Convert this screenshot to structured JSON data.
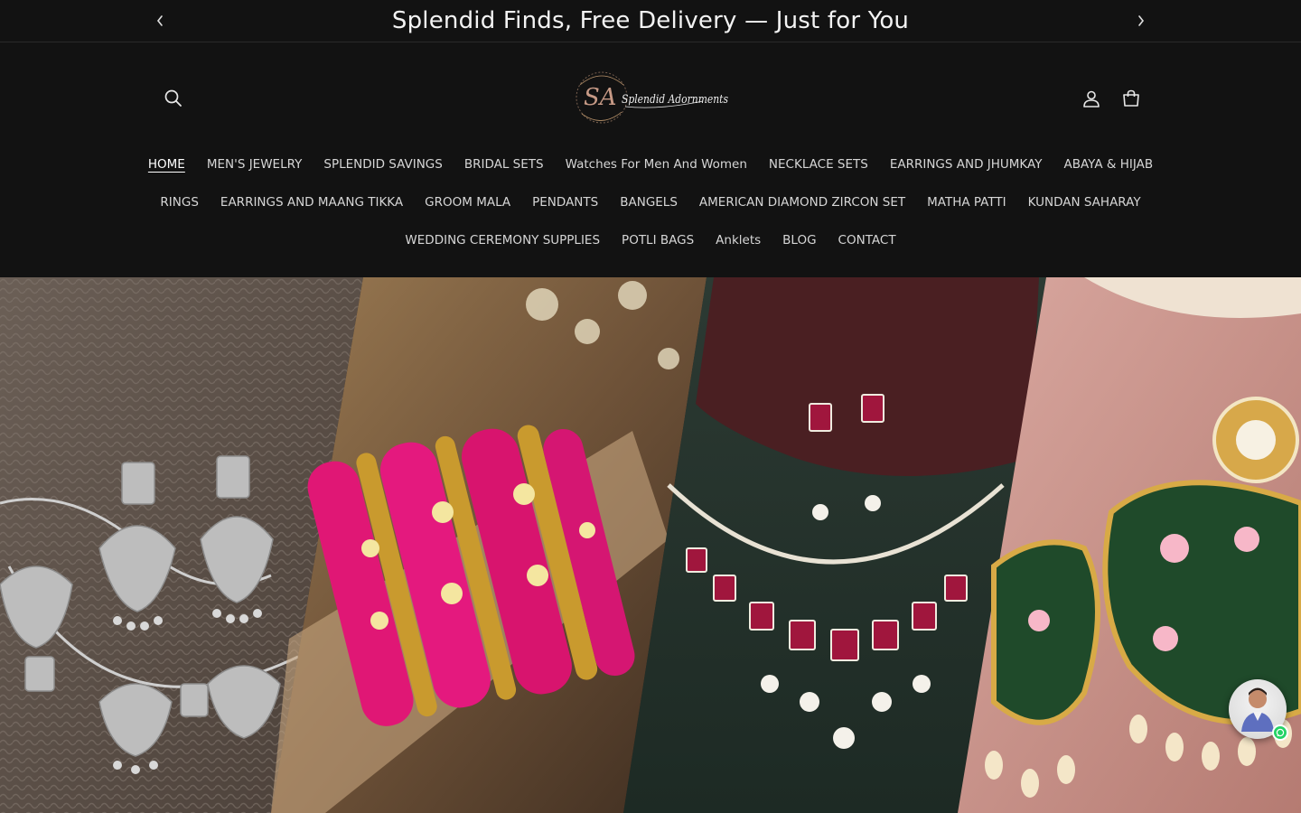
{
  "announcement": {
    "text": "Splendid Finds, Free Delivery — Just for You"
  },
  "header": {
    "logo_monogram": "SA",
    "logo_script": "Splendid Adornments",
    "icons": [
      "search-icon",
      "account-icon",
      "cart-icon"
    ]
  },
  "nav": {
    "row1": [
      "HOME",
      "MEN'S JEWELRY",
      "SPLENDID SAVINGS",
      "BRIDAL SETS",
      "Watches For Men And Women",
      "NECKLACE SETS",
      "EARRINGS AND JHUMKAY",
      "ABAYA & HIJAB"
    ],
    "row2": [
      "RINGS",
      "EARRINGS AND MAANG TIKKA",
      "GROOM MALA",
      "PENDANTS",
      "BANGELS",
      "AMERICAN DIAMOND ZIRCON SET",
      "MATHA PATTI",
      "KUNDAN SAHARAY"
    ],
    "row3": [
      "WEDDING CEREMONY SUPPLIES",
      "POTLI BAGS",
      "Anklets",
      "BLOG",
      "CONTACT"
    ],
    "active": "HOME"
  },
  "colors": {
    "background": "#121212",
    "text": "#d6d6d6",
    "logo_gold": "#b8926a",
    "whatsapp": "#25d366"
  }
}
